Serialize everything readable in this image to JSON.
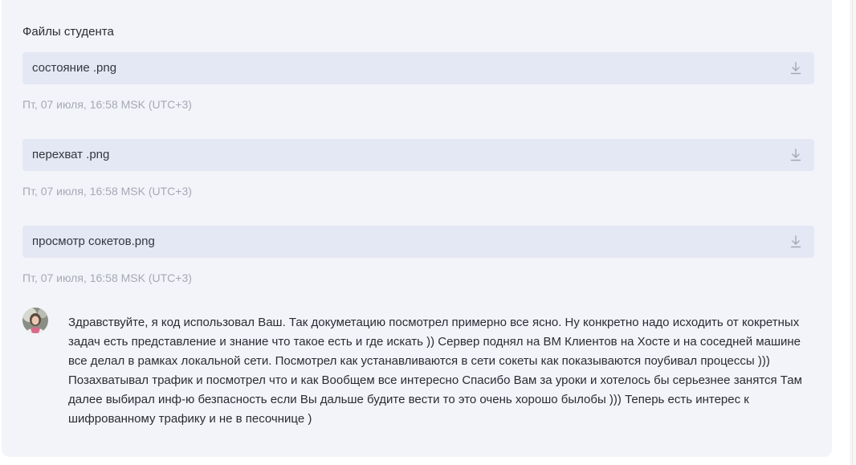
{
  "section": {
    "title": "Файлы студента"
  },
  "files": [
    {
      "name": "состояние .png",
      "timestamp": "Пт, 07 июля, 16:58 MSK (UTC+3)",
      "icon": "download-icon"
    },
    {
      "name": "перехват .png",
      "timestamp": "Пт, 07 июля, 16:58 MSK (UTC+3)",
      "icon": "download-icon"
    },
    {
      "name": "просмотр сокетов.png",
      "timestamp": "Пт, 07 июля, 16:58 MSK (UTC+3)",
      "icon": "download-icon"
    }
  ],
  "comment": {
    "text": "Здравствуйте, я код использовал Ваш. Так докуметацию посмотрел примерно все ясно. Ну конкретно надо исходить от кокретных задач есть представление и знание что такое есть и где искать )) Сервер поднял на ВМ Клиентов на Хосте и на соседней машине все делал в рамках локальной сети. Посмотрел как устанавливаются в сети сокеты как показываются поубивал процессы ))) Позахватывал трафик и посмотрел что и как Вообщем все интересно Спасибо Вам за уроки и хотелось бы серьезнее занятся Там далее выбирал инф-ю безпасность если Вы дальше будите вести то это очень хорошо былобы ))) Теперь есть интерес к шифрованному трафику и не в песочнице )"
  },
  "colors": {
    "panel_bg": "#f3f4f9",
    "file_row_bg": "#e4e7f4",
    "text": "#2b2b33",
    "muted": "#a6a9b4"
  }
}
